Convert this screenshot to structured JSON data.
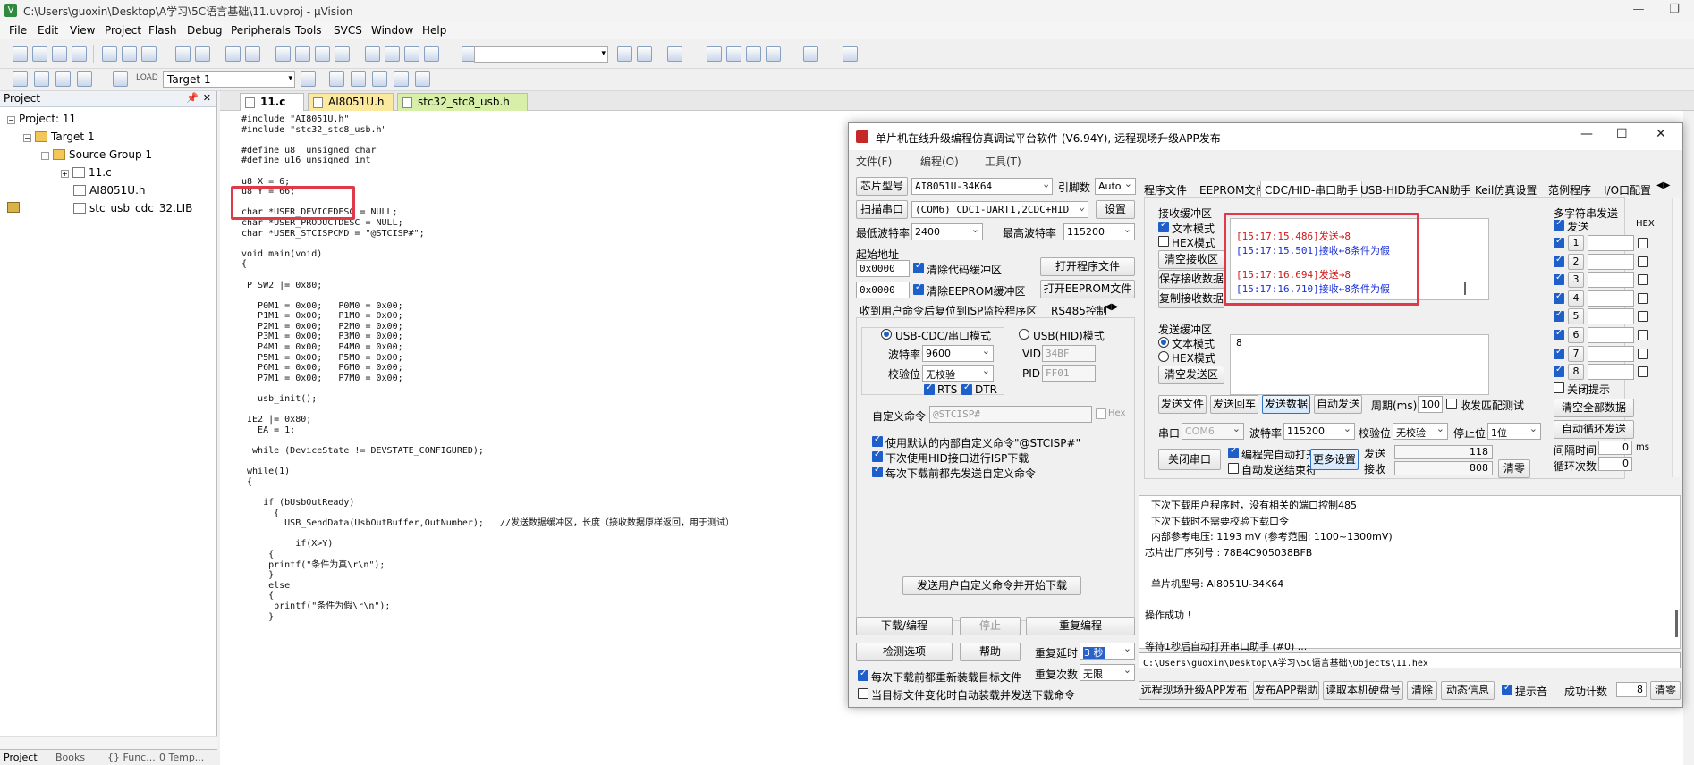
{
  "window": {
    "title": "C:\\Users\\guoxin\\Desktop\\A学习\\5C语言基础\\11.uvproj - µVision",
    "min": "—",
    "restore": "❐",
    "close": "✕"
  },
  "menu": [
    "File",
    "Edit",
    "View",
    "Project",
    "Flash",
    "Debug",
    "Peripherals",
    "Tools",
    "SVCS",
    "Window",
    "Help"
  ],
  "toolbar": {
    "target": "Target 1",
    "load": "LOAD"
  },
  "project_panel": {
    "title": "Project",
    "project": "Project: 11",
    "target": "Target 1",
    "group": "Source Group 1",
    "files": [
      "11.c",
      "AI8051U.h",
      "stc_usb_cdc_32.LIB"
    ],
    "bottom_tabs": [
      "Project",
      "Books",
      "{} Func...",
      "0 Temp..."
    ]
  },
  "editor": {
    "tabs": [
      "11.c",
      "AI8051U.h",
      "stc32_stc8_usb.h"
    ],
    "lines": [
      "#include \"AI8051U.h\"",
      "#include \"stc32_stc8_usb.h\"",
      "",
      "#define u8  unsigned char",
      "#define u16 unsigned int",
      "",
      "u8 X = 6;",
      "u8 Y = 66;",
      "",
      "char *USER_DEVICEDESC = NULL;",
      "char *USER_PRODUCTDESC = NULL;",
      "char *USER_STCISPCMD = \"@STCISP#\";",
      "",
      "void main(void)",
      "{",
      "",
      " P_SW2 |= 0x80;",
      "",
      "   P0M1 = 0x00;   P0M0 = 0x00;",
      "   P1M1 = 0x00;   P1M0 = 0x00;",
      "   P2M1 = 0x00;   P2M0 = 0x00;",
      "   P3M1 = 0x00;   P3M0 = 0x00;",
      "   P4M1 = 0x00;   P4M0 = 0x00;",
      "   P5M1 = 0x00;   P5M0 = 0x00;",
      "   P6M1 = 0x00;   P6M0 = 0x00;",
      "   P7M1 = 0x00;   P7M0 = 0x00;",
      "",
      "   usb_init();",
      "",
      " IE2 |= 0x80;",
      "   EA = 1;",
      "",
      "  while (DeviceState != DEVSTATE_CONFIGURED);",
      "",
      " while(1)",
      " {",
      "",
      "    if (bUsbOutReady)",
      "      {",
      "        USB_SendData(UsbOutBuffer,OutNumber);   //发送数据缓冲区，长度（接收数据原样返回，用于测试）",
      "",
      "          if(X>Y)",
      "     {",
      "     printf(\"条件为真\\r\\n\");",
      "     }",
      "     else",
      "     {",
      "      printf(\"条件为假\\r\\n\");",
      "     }"
    ]
  },
  "stc": {
    "title": "单片机在线升级编程仿真调试平台软件 (V6.94Y), 远程现场升级APP发布",
    "menu": [
      "文件(F)",
      "编程(O)",
      "工具(T)"
    ],
    "chip_label": "芯片型号",
    "chip": "AI8051U-34K64",
    "pin_label": "引脚数",
    "pin": "Auto",
    "scan_btn": "扫描串口",
    "port": "(COM6) CDC1-UART1,2CDC+HID",
    "settings_btn": "设置",
    "min_baud_label": "最低波特率",
    "min_baud": "2400",
    "max_baud_label": "最高波特率",
    "max_baud": "115200",
    "start_addr_label": "起始地址",
    "addr1": "0x0000",
    "clear_code": "清除代码缓冲区",
    "open_prog": "打开程序文件",
    "addr2": "0x0000",
    "clear_eeprom": "清除EEPROM缓冲区",
    "open_eeprom": "打开EEPROM文件",
    "left_tabs": [
      "收到用户命令后复位到ISP监控程序区",
      "RS485控制"
    ],
    "usb_cdc_mode": "USB-CDC/串口模式",
    "usb_hid_mode": "USB(HID)模式",
    "baud_label": "波特率",
    "baud": "9600",
    "parity_label": "校验位",
    "parity": "无校验",
    "rts": "RTS",
    "dtr": "DTR",
    "vid_label": "VID",
    "vid": "34BF",
    "pid_label": "PID",
    "pid": "FF01",
    "custom_cmd_label": "自定义命令",
    "custom_cmd": "@STCISP#",
    "hex": "Hex",
    "opt1": "使用默认的内部自定义命令\"@STCISP#\"",
    "opt2": "下次使用HID接口进行ISP下载",
    "opt3": "每次下载前都先发送自定义命令",
    "send_cmd_btn": "发送用户自定义命令并开始下载",
    "download_btn": "下载/编程",
    "stop_btn": "停止",
    "reprog_btn": "重复编程",
    "check_btn": "检测选项",
    "help_btn": "帮助",
    "repeat_delay_label": "重复延时",
    "repeat_delay": "3 秒",
    "repeat_count_label": "重复次数",
    "repeat_count": "无限",
    "reload_opt": "每次下载前都重新装载目标文件",
    "auto_opt": "当目标文件变化时自动装载并发送下载命令",
    "right_tabs": [
      "程序文件",
      "EEPROM文件",
      "CDC/HID-串口助手",
      "USB-HID助手",
      "CAN助手",
      "Keil仿真设置",
      "范例程序",
      "I/O口配置"
    ],
    "recv_title": "接收缓冲区",
    "text_mode": "文本模式",
    "hex_mode": "HEX模式",
    "clear_recv": "清空接收区",
    "save_recv": "保存接收数据",
    "copy_recv": "复制接收数据",
    "recv_lines": [
      {
        "ts": "[15:17:15.486]",
        "msg": "发送→8"
      },
      {
        "ts": "[15:17:15.501]",
        "msg": "接收←8条件为假"
      },
      {
        "ts": "[15:17:16.694]",
        "msg": "发送→8"
      },
      {
        "ts": "[15:17:16.710]",
        "msg": "接收←8条件为假"
      }
    ],
    "send_title": "发送缓冲区",
    "send_text": "8",
    "clear_send": "清空发送区",
    "send_file": "发送文件",
    "send_cr": "发送回车",
    "send_data": "发送数据",
    "auto_send": "自动发送",
    "period_label": "周期(ms)",
    "period": "100",
    "match_test": "收发匹配测试",
    "port_label": "串口",
    "port2": "COM6",
    "baud2_label": "波特率",
    "baud2": "115200",
    "parity2_label": "校验位",
    "parity2": "无校验",
    "stop_label": "停止位",
    "stop": "1位",
    "close_port": "关闭串口",
    "auto_open": "编程完自动打开",
    "auto_end": "自动发送结束符",
    "more_settings": "更多设置",
    "sent_label": "发送",
    "sent_count": "118",
    "recv_label": "接收",
    "recv_count": "808",
    "clear_count": "清零",
    "multi_title": "多字符串发送",
    "multi_send": "发送",
    "multi_hex": "HEX",
    "multi_rows": [
      "1",
      "2",
      "3",
      "4",
      "5",
      "6",
      "7",
      "8"
    ],
    "close_hint": "关闭提示",
    "clear_all": "清空全部数据",
    "auto_loop": "自动循环发送",
    "interval_label": "间隔时间",
    "interval": "0",
    "interval_unit": "ms",
    "loop_label": "循环次数",
    "loop": "0",
    "log": [
      "  下次下载用户程序时，没有相关的端口控制485",
      "  下次下载时不需要校验下载口令",
      "  内部参考电压: 1193 mV (参考范围: 1100~1300mV)",
      "芯片出厂序列号 : 78B4C905038BFB",
      "",
      "  单片机型号: AI8051U-34K64",
      "",
      "操作成功 !",
      "",
      "等待1秒后自动打开串口助手 (#0) ..."
    ],
    "path": "C:\\Users\\guoxin\\Desktop\\A学习\\5C语言基础\\Objects\\11.hex",
    "footer_btns": [
      "远程现场升级APP发布",
      "发布APP帮助",
      "读取本机硬盘号",
      "清除",
      "动态信息"
    ],
    "beep": "提示音",
    "success_label": "成功计数",
    "success": "8",
    "clear_success": "清零"
  }
}
